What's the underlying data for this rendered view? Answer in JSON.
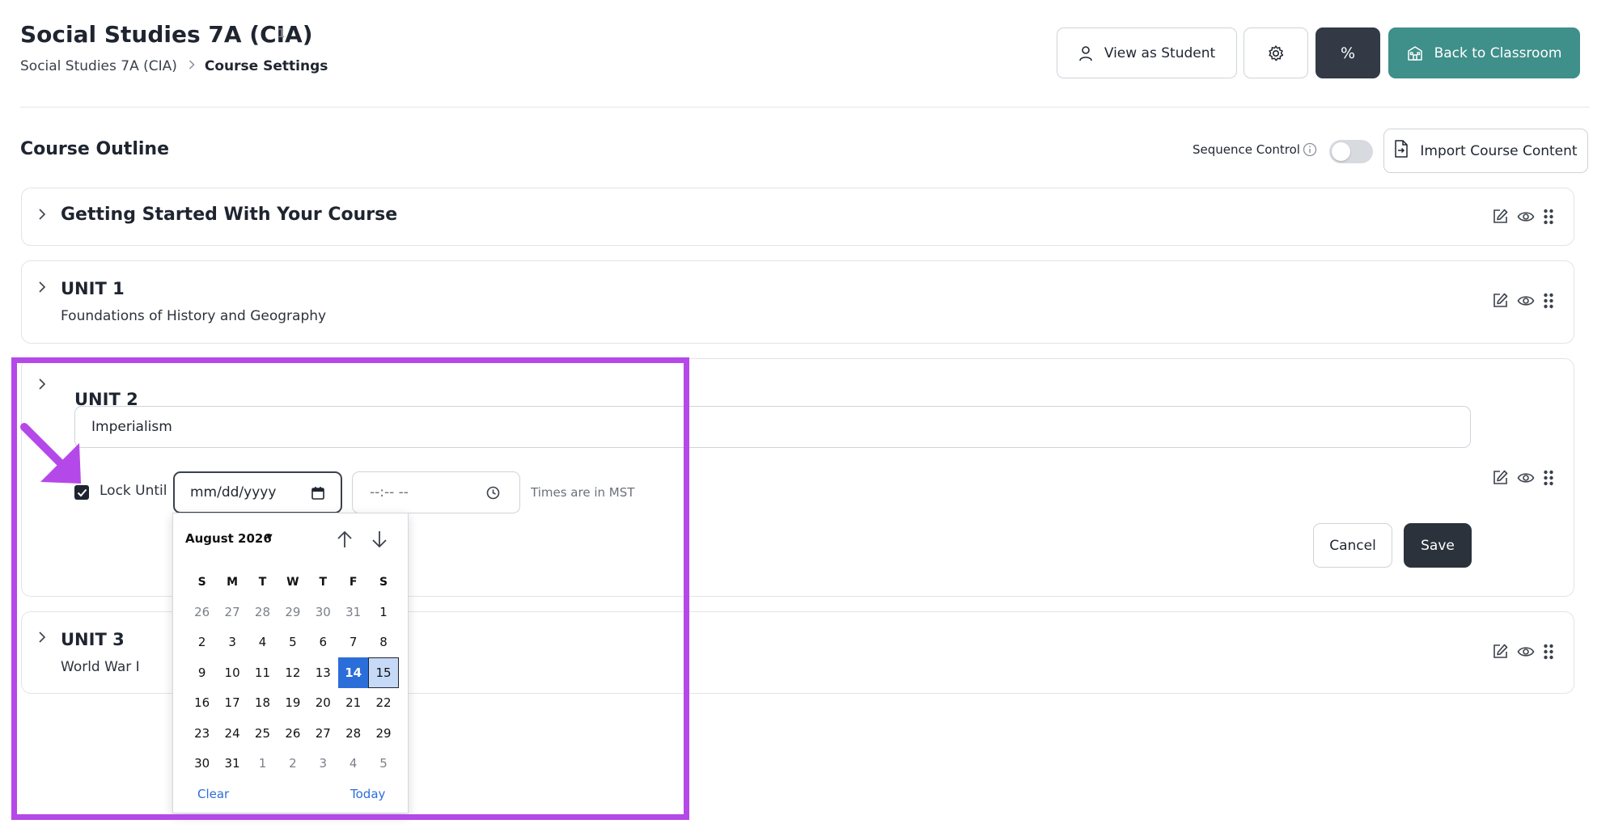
{
  "header": {
    "title": "Social Studies 7A (CIA)",
    "count": "1",
    "breadcrumb_parent": "Social Studies 7A (CIA)",
    "breadcrumb_current": "Course Settings",
    "view_as_student_label": "View as Student",
    "percent_label": "%",
    "back_to_classroom_label": "Back to Classroom"
  },
  "outline": {
    "title": "Course Outline",
    "sequence_control_label": "Sequence Control",
    "sequence_control_on": false,
    "import_label": "Import Course Content"
  },
  "units": [
    {
      "title": "Getting Started With Your Course"
    },
    {
      "title": "UNIT 1",
      "subtitle": "Foundations of History and Geography"
    },
    {
      "title": "UNIT 2",
      "input_value": "Imperialism",
      "lock_checked": true,
      "lock_label": "Lock Until",
      "date_placeholder": "mm/dd/yyyy",
      "time_placeholder": "--:-- --",
      "timezone_note": "Times are in MST",
      "cancel_label": "Cancel",
      "save_label": "Save"
    },
    {
      "title": "UNIT 3",
      "subtitle": "World War I"
    }
  ],
  "datepicker": {
    "month_label": "August 2026",
    "weekdays": [
      "S",
      "M",
      "T",
      "W",
      "T",
      "F",
      "S"
    ],
    "weeks": [
      [
        "26",
        "27",
        "28",
        "29",
        "30",
        "31",
        "1"
      ],
      [
        "2",
        "3",
        "4",
        "5",
        "6",
        "7",
        "8"
      ],
      [
        "9",
        "10",
        "11",
        "12",
        "13",
        "14",
        "15"
      ],
      [
        "16",
        "17",
        "18",
        "19",
        "20",
        "21",
        "22"
      ],
      [
        "23",
        "24",
        "25",
        "26",
        "27",
        "28",
        "29"
      ],
      [
        "30",
        "31",
        "1",
        "2",
        "3",
        "4",
        "5"
      ]
    ],
    "selected_day": "14",
    "focused_day": "15",
    "clear_label": "Clear",
    "today_label": "Today"
  },
  "colors": {
    "accent_teal": "#3f8f8a",
    "dark_button": "#333a46",
    "highlight": "#b548e8",
    "selected_day": "#2b6ed9"
  }
}
